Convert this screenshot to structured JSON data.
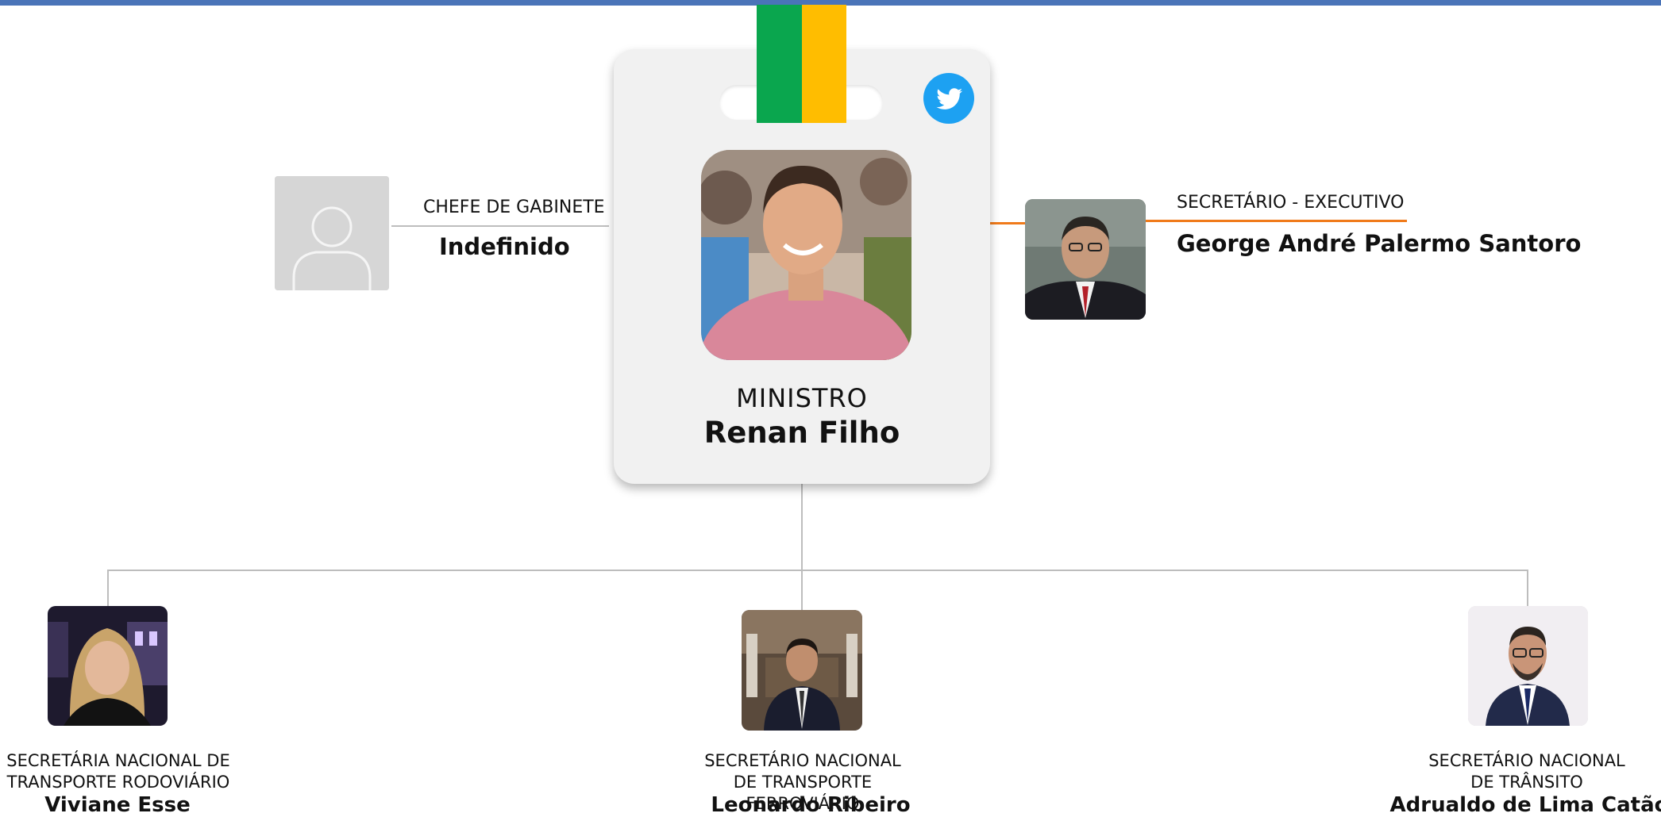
{
  "colors": {
    "top_bar": "#4a74b8",
    "ribbon_green": "#0aa64e",
    "ribbon_yellow": "#ffbd00",
    "connector_gray": "#bdbdbd",
    "connector_orange": "#f07a1a",
    "twitter_blue": "#1da1f2"
  },
  "minister": {
    "role": "MINISTRO",
    "name": "Renan Filho",
    "social_icon": "twitter-icon"
  },
  "chief_of_staff": {
    "role": "CHEFE DE GABINETE",
    "name": "Indefinido",
    "photo": "placeholder-avatar-icon"
  },
  "executive_secretary": {
    "role": "SECRETÁRIO - EXECUTIVO",
    "name": "George André Palermo Santoro"
  },
  "secretaries": [
    {
      "role": "SECRETÁRIA NACIONAL DE TRANSPORTE RODOVIÁRIO",
      "name": "Viviane Esse"
    },
    {
      "role": "SECRETÁRIO NACIONAL DE TRANSPORTE FERROVIÁRIO",
      "name": "Leonardo Ribeiro"
    },
    {
      "role": "SECRETÁRIO NACIONAL DE TRÂNSITO",
      "name": "Adrualdo de Lima Catão"
    }
  ]
}
